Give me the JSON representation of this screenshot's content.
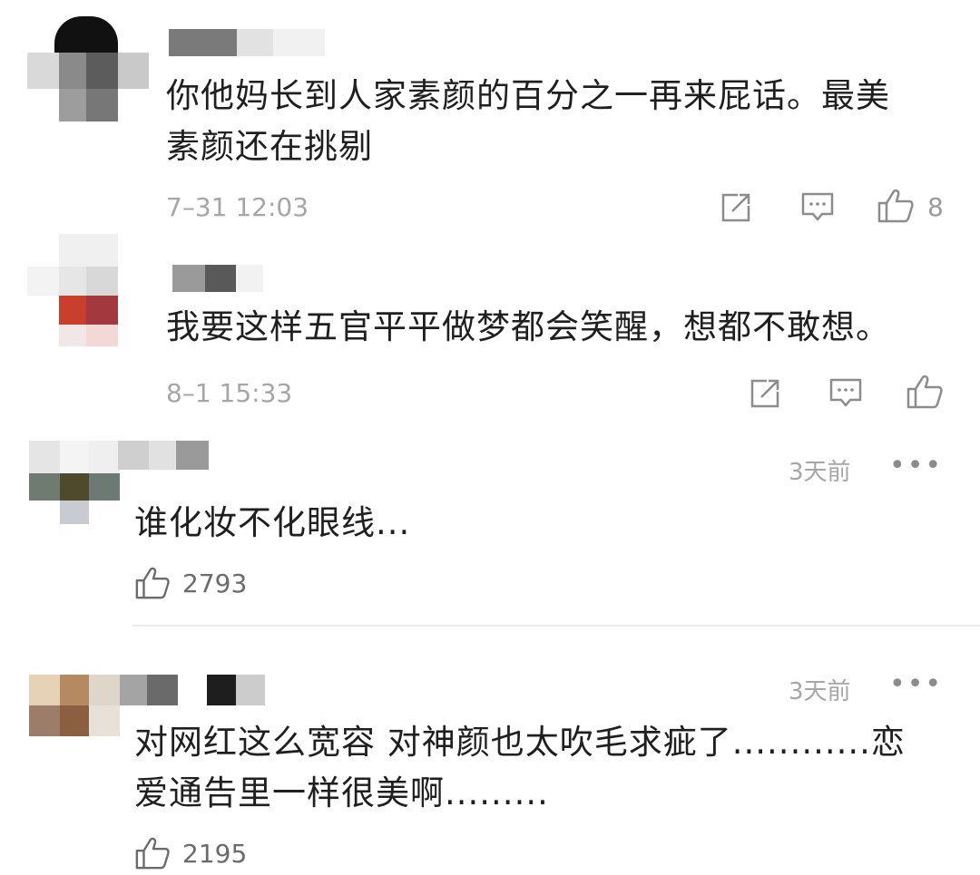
{
  "comments": [
    {
      "text_lines": [
        "你他妈长到人家素颜的百分之一再来屁话。最美",
        "素颜还在挑剔"
      ],
      "time": "7–31 12:03",
      "like_count": "8",
      "icons": [
        "share-icon",
        "comment-icon",
        "thumbs-up-icon"
      ]
    },
    {
      "text_lines": [
        "我要这样五官平平做梦都会笑醒，想都不敢想。"
      ],
      "time": "8–1 15:33",
      "icons": [
        "share-icon",
        "comment-icon",
        "thumbs-up-icon"
      ]
    },
    {
      "text_lines": [
        "谁化妆不化眼线..."
      ],
      "ago": "3天前",
      "more": "•••",
      "like_count": "2793",
      "icons": [
        "thumbs-up-icon",
        "more-icon"
      ]
    },
    {
      "text_lines": [
        "对网红这么宽容 对神颜也太吹毛求疵了............恋",
        "爱通告里一样很美啊........."
      ],
      "ago": "3天前",
      "more": "•••",
      "like_count": "2195",
      "icons": [
        "thumbs-up-icon",
        "more-icon"
      ]
    }
  ],
  "colors": {
    "text": "#1f1f1f",
    "meta": "#a6a6a6",
    "icon": "#8c8c8c",
    "divider": "#ececec"
  }
}
